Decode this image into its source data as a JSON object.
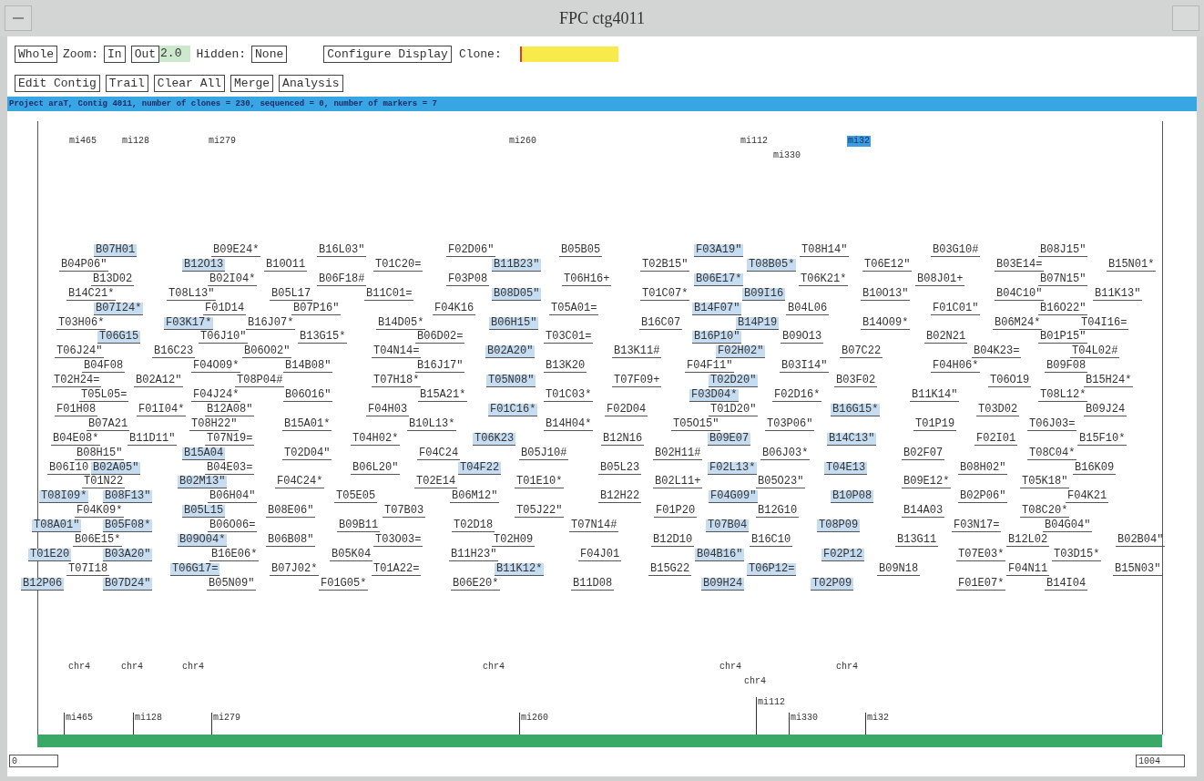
{
  "window": {
    "title": "FPC ctg4011"
  },
  "toolbar": {
    "row_1": [
      {
        "kind": "button",
        "label": "Whole"
      },
      {
        "kind": "label",
        "label": "Zoom:"
      },
      {
        "kind": "button",
        "label": "In"
      },
      {
        "kind": "button",
        "label": "Out"
      },
      {
        "kind": "value",
        "label": "2.0"
      },
      {
        "kind": "label",
        "label": "Hidden:"
      },
      {
        "kind": "button",
        "label": "None"
      },
      {
        "kind": "button",
        "label": "Configure Display"
      },
      {
        "kind": "label",
        "label": "Clone:"
      },
      {
        "kind": "field"
      }
    ],
    "row_2": [
      {
        "kind": "button",
        "label": "Edit Contig"
      },
      {
        "kind": "button",
        "label": "Trail"
      },
      {
        "kind": "button",
        "label": "Clear All"
      },
      {
        "kind": "button",
        "label": "Merge"
      },
      {
        "kind": "button",
        "label": "Analysis"
      }
    ]
  },
  "status_bar": "Project araT, Contig 4011, number of clones = 230, sequenced = 0, number of markers = 7",
  "markers": [
    {
      "label": "mi465",
      "selected": false
    },
    {
      "label": "mi128",
      "selected": false
    },
    {
      "label": "mi279",
      "selected": false
    },
    {
      "label": "mi260",
      "selected": false
    },
    {
      "label": "mi112",
      "selected": false
    },
    {
      "label": "mi32",
      "selected": true
    },
    {
      "label": "mi330",
      "selected": false
    }
  ],
  "clone_rows": [
    [
      {
        "name": "B07H01",
        "highlighted": true
      },
      {
        "name": "B09E24*",
        "highlighted": false
      },
      {
        "name": "B16L03\"",
        "highlighted": false
      },
      {
        "name": "F02D06\"",
        "highlighted": false
      },
      {
        "name": "B05B05",
        "highlighted": false
      },
      {
        "name": "F03A19\"",
        "highlighted": true
      },
      {
        "name": "T08H14\"",
        "highlighted": false
      },
      {
        "name": "B03G10#",
        "highlighted": false
      },
      {
        "name": "B08J15\"",
        "highlighted": false
      }
    ],
    [
      {
        "name": "B04P06\"",
        "highlighted": false
      },
      {
        "name": "B12O13",
        "highlighted": true
      },
      {
        "name": "B10O11",
        "highlighted": false
      },
      {
        "name": "T01C20=",
        "highlighted": false
      },
      {
        "name": "B11B23\"",
        "highlighted": true
      },
      {
        "name": "T02B15\"",
        "highlighted": false
      },
      {
        "name": "T08B05*",
        "highlighted": true
      },
      {
        "name": "T06E12\"",
        "highlighted": false
      },
      {
        "name": "B03E14=",
        "highlighted": false
      },
      {
        "name": "B15N01*",
        "highlighted": false
      }
    ],
    [
      {
        "name": "B13D02",
        "highlighted": false
      },
      {
        "name": "B02I04*",
        "highlighted": false
      },
      {
        "name": "B06F18#",
        "highlighted": false
      },
      {
        "name": "F03P08",
        "highlighted": false
      },
      {
        "name": "T06H16+",
        "highlighted": false
      },
      {
        "name": "B06E17*",
        "highlighted": true
      },
      {
        "name": "T06K21*",
        "highlighted": false
      },
      {
        "name": "B08J01+",
        "highlighted": false
      },
      {
        "name": "B07N15\"",
        "highlighted": false
      }
    ],
    [
      {
        "name": "B14C21*",
        "highlighted": false
      },
      {
        "name": "T08L13\"",
        "highlighted": false
      },
      {
        "name": "B05L17",
        "highlighted": false
      },
      {
        "name": "B11C01=",
        "highlighted": false
      },
      {
        "name": "B08D05\"",
        "highlighted": true
      },
      {
        "name": "T01C07*",
        "highlighted": false
      },
      {
        "name": "B09I16",
        "highlighted": true
      },
      {
        "name": "B10O13\"",
        "highlighted": false
      },
      {
        "name": "B04C10\"",
        "highlighted": false
      },
      {
        "name": "B11K13\"",
        "highlighted": false
      }
    ],
    [
      {
        "name": "B07I24*",
        "highlighted": true
      },
      {
        "name": "F01D14",
        "highlighted": false
      },
      {
        "name": "B07P16\"",
        "highlighted": false
      },
      {
        "name": "F04K16",
        "highlighted": false
      },
      {
        "name": "T05A01=",
        "highlighted": false
      },
      {
        "name": "B14F07\"",
        "highlighted": true
      },
      {
        "name": "B04L06",
        "highlighted": false
      },
      {
        "name": "F01C01\"",
        "highlighted": false
      },
      {
        "name": "B16O22\"",
        "highlighted": false
      }
    ],
    [
      {
        "name": "T03H06*",
        "highlighted": false
      },
      {
        "name": "F03K17*",
        "highlighted": true
      },
      {
        "name": "B16J07*",
        "highlighted": false
      },
      {
        "name": "B14D05*",
        "highlighted": false
      },
      {
        "name": "B06H15\"",
        "highlighted": true
      },
      {
        "name": "B16C07",
        "highlighted": false
      },
      {
        "name": "B14P19",
        "highlighted": true
      },
      {
        "name": "B14O09*",
        "highlighted": false
      },
      {
        "name": "B06M24*",
        "highlighted": false
      },
      {
        "name": "T04I16=",
        "highlighted": false
      }
    ],
    [
      {
        "name": "T06G15",
        "highlighted": true
      },
      {
        "name": "T06J10\"",
        "highlighted": false
      },
      {
        "name": "B13G15*",
        "highlighted": false
      },
      {
        "name": "B06D02=",
        "highlighted": false
      },
      {
        "name": "T03C01=",
        "highlighted": false
      },
      {
        "name": "B16P10\"",
        "highlighted": true
      },
      {
        "name": "B09O13",
        "highlighted": false
      },
      {
        "name": "B02N21",
        "highlighted": false
      },
      {
        "name": "B01P15\"",
        "highlighted": false
      }
    ],
    [
      {
        "name": "T06J24\"",
        "highlighted": false
      },
      {
        "name": "B16C23",
        "highlighted": false
      },
      {
        "name": "B06O02\"",
        "highlighted": false
      },
      {
        "name": "T04N14=",
        "highlighted": false
      },
      {
        "name": "B02A20\"",
        "highlighted": true
      },
      {
        "name": "B13K11#",
        "highlighted": false
      },
      {
        "name": "F02H02\"",
        "highlighted": true
      },
      {
        "name": "B07C22",
        "highlighted": false
      },
      {
        "name": "B04K23=",
        "highlighted": false
      },
      {
        "name": "T04L02#",
        "highlighted": false
      }
    ],
    [
      {
        "name": "B04F08",
        "highlighted": false
      },
      {
        "name": "F04O09*",
        "highlighted": false
      },
      {
        "name": "B14B08\"",
        "highlighted": false
      },
      {
        "name": "B16J17\"",
        "highlighted": false
      },
      {
        "name": "B13K20",
        "highlighted": false
      },
      {
        "name": "F04F11\"",
        "highlighted": false
      },
      {
        "name": "B03I14\"",
        "highlighted": false
      },
      {
        "name": "F04H06*",
        "highlighted": false
      },
      {
        "name": "B09F08",
        "highlighted": false
      }
    ],
    [
      {
        "name": "T02H24=",
        "highlighted": false
      },
      {
        "name": "B02A12\"",
        "highlighted": false
      },
      {
        "name": "T08P04#",
        "highlighted": false
      },
      {
        "name": "T07H18*",
        "highlighted": false
      },
      {
        "name": "T05N08\"",
        "highlighted": true
      },
      {
        "name": "T07F09+",
        "highlighted": false
      },
      {
        "name": "T02D20\"",
        "highlighted": true
      },
      {
        "name": "B03F02",
        "highlighted": false
      },
      {
        "name": "T06O19",
        "highlighted": false
      },
      {
        "name": "B15H24*",
        "highlighted": false
      }
    ],
    [
      {
        "name": "T05L05=",
        "highlighted": false
      },
      {
        "name": "F04J24*",
        "highlighted": false
      },
      {
        "name": "B06O16\"",
        "highlighted": false
      },
      {
        "name": "B15A21*",
        "highlighted": false
      },
      {
        "name": "T01C03*",
        "highlighted": false
      },
      {
        "name": "F03D04*",
        "highlighted": true
      },
      {
        "name": "F02D16*",
        "highlighted": false
      },
      {
        "name": "B11K14\"",
        "highlighted": false
      },
      {
        "name": "T08L12*",
        "highlighted": false
      }
    ],
    [
      {
        "name": "F01H08",
        "highlighted": false
      },
      {
        "name": "F01I04*",
        "highlighted": false
      },
      {
        "name": "B12A08\"",
        "highlighted": false
      },
      {
        "name": "F04H03",
        "highlighted": false
      },
      {
        "name": "F01C16*",
        "highlighted": true
      },
      {
        "name": "F02D04",
        "highlighted": false
      },
      {
        "name": "T01D20\"",
        "highlighted": false
      },
      {
        "name": "B16G15*",
        "highlighted": true
      },
      {
        "name": "T03D02",
        "highlighted": false
      },
      {
        "name": "B09J24",
        "highlighted": false
      }
    ],
    [
      {
        "name": "B07A21",
        "highlighted": false
      },
      {
        "name": "T08H22\"",
        "highlighted": false
      },
      {
        "name": "B15A01*",
        "highlighted": false
      },
      {
        "name": "B10L13*",
        "highlighted": false
      },
      {
        "name": "B14H04*",
        "highlighted": false
      },
      {
        "name": "T05O15\"",
        "highlighted": false
      },
      {
        "name": "T03P06\"",
        "highlighted": false
      },
      {
        "name": "T01P19",
        "highlighted": false
      },
      {
        "name": "T06J03=",
        "highlighted": false
      }
    ],
    [
      {
        "name": "B04E08*",
        "highlighted": false
      },
      {
        "name": "B11D11\"",
        "highlighted": false
      },
      {
        "name": "T07N19=",
        "highlighted": false
      },
      {
        "name": "T04H02*",
        "highlighted": false
      },
      {
        "name": "T06K23",
        "highlighted": true
      },
      {
        "name": "B12N16",
        "highlighted": false
      },
      {
        "name": "B09E07",
        "highlighted": true
      },
      {
        "name": "B14C13\"",
        "highlighted": true
      },
      {
        "name": "F02I01",
        "highlighted": false
      },
      {
        "name": "B15F10*",
        "highlighted": false
      }
    ],
    [
      {
        "name": "B08H15\"",
        "highlighted": false
      },
      {
        "name": "B15A04",
        "highlighted": true
      },
      {
        "name": "T02D04\"",
        "highlighted": false
      },
      {
        "name": "F04C24",
        "highlighted": false
      },
      {
        "name": "B05J10#",
        "highlighted": false
      },
      {
        "name": "B02H11#",
        "highlighted": false
      },
      {
        "name": "B06J03*",
        "highlighted": false
      },
      {
        "name": "B02F07",
        "highlighted": false
      },
      {
        "name": "T08C04*",
        "highlighted": false
      }
    ],
    [
      {
        "name": "B06I10",
        "highlighted": false
      },
      {
        "name": "B02A05\"",
        "highlighted": true
      },
      {
        "name": "B04E03=",
        "highlighted": false
      },
      {
        "name": "B06L20\"",
        "highlighted": false
      },
      {
        "name": "T04F22",
        "highlighted": true
      },
      {
        "name": "B05L23",
        "highlighted": false
      },
      {
        "name": "F02L13*",
        "highlighted": true
      },
      {
        "name": "T04E13",
        "highlighted": true
      },
      {
        "name": "B08H02\"",
        "highlighted": false
      },
      {
        "name": "B16K09",
        "highlighted": false
      }
    ],
    [
      {
        "name": "T01N22",
        "highlighted": false
      },
      {
        "name": "B02M13\"",
        "highlighted": true
      },
      {
        "name": "F04C24*",
        "highlighted": false
      },
      {
        "name": "T02E14",
        "highlighted": false
      },
      {
        "name": "T01E10*",
        "highlighted": false
      },
      {
        "name": "B02L11+",
        "highlighted": false
      },
      {
        "name": "B05O23\"",
        "highlighted": false
      },
      {
        "name": "B09E12*",
        "highlighted": false
      },
      {
        "name": "T05K18\"",
        "highlighted": false
      }
    ],
    [
      {
        "name": "T08I09*",
        "highlighted": true
      },
      {
        "name": "B08F13\"",
        "highlighted": true
      },
      {
        "name": "B06H04\"",
        "highlighted": false
      },
      {
        "name": "T05E05",
        "highlighted": false
      },
      {
        "name": "B06M12\"",
        "highlighted": false
      },
      {
        "name": "B12H22",
        "highlighted": false
      },
      {
        "name": "F04G09\"",
        "highlighted": true
      },
      {
        "name": "B10P08",
        "highlighted": true
      },
      {
        "name": "B02P06\"",
        "highlighted": false
      },
      {
        "name": "F04K21",
        "highlighted": false
      }
    ],
    [
      {
        "name": "F04K09*",
        "highlighted": false
      },
      {
        "name": "B05L15",
        "highlighted": true
      },
      {
        "name": "B08E06\"",
        "highlighted": false
      },
      {
        "name": "T07B03",
        "highlighted": false
      },
      {
        "name": "T05J22\"",
        "highlighted": false
      },
      {
        "name": "F01P20",
        "highlighted": false
      },
      {
        "name": "B12G10",
        "highlighted": false
      },
      {
        "name": "B14A03",
        "highlighted": false
      },
      {
        "name": "T08C20*",
        "highlighted": false
      }
    ],
    [
      {
        "name": "T08A01\"",
        "highlighted": true
      },
      {
        "name": "B05F08*",
        "highlighted": true
      },
      {
        "name": "B06O06=",
        "highlighted": false
      },
      {
        "name": "B09B11",
        "highlighted": false
      },
      {
        "name": "T02D18",
        "highlighted": false
      },
      {
        "name": "T07N14#",
        "highlighted": false
      },
      {
        "name": "T07B04",
        "highlighted": true
      },
      {
        "name": "T08P09",
        "highlighted": true
      },
      {
        "name": "F03N17=",
        "highlighted": false
      },
      {
        "name": "B04G04\"",
        "highlighted": false
      }
    ],
    [
      {
        "name": "B06E15*",
        "highlighted": false
      },
      {
        "name": "B09O04*",
        "highlighted": true
      },
      {
        "name": "B06B08\"",
        "highlighted": false
      },
      {
        "name": "T03O03=",
        "highlighted": false
      },
      {
        "name": "T02H09",
        "highlighted": false
      },
      {
        "name": "B12D10",
        "highlighted": false
      },
      {
        "name": "B16C10",
        "highlighted": false
      },
      {
        "name": "B13G11",
        "highlighted": false
      },
      {
        "name": "B12L02",
        "highlighted": false
      },
      {
        "name": "B02B04\"",
        "highlighted": false
      }
    ],
    [
      {
        "name": "T01E20",
        "highlighted": true
      },
      {
        "name": "B03A20\"",
        "highlighted": true
      },
      {
        "name": "B16E06*",
        "highlighted": false
      },
      {
        "name": "B05K04",
        "highlighted": false
      },
      {
        "name": "B11H23\"",
        "highlighted": false
      },
      {
        "name": "F04J01",
        "highlighted": false
      },
      {
        "name": "B04B16\"",
        "highlighted": true
      },
      {
        "name": "F02P12",
        "highlighted": true
      },
      {
        "name": "T07E03*",
        "highlighted": false
      },
      {
        "name": "T03D15*",
        "highlighted": false
      }
    ],
    [
      {
        "name": "T07I18",
        "highlighted": false
      },
      {
        "name": "T06G17=",
        "highlighted": true
      },
      {
        "name": "B07J02*",
        "highlighted": false
      },
      {
        "name": "T01A22=",
        "highlighted": false
      },
      {
        "name": "B11K12*",
        "highlighted": true
      },
      {
        "name": "B15G22",
        "highlighted": false
      },
      {
        "name": "T06P12=",
        "highlighted": true
      },
      {
        "name": "B09N18",
        "highlighted": false
      },
      {
        "name": "F04N11",
        "highlighted": false
      },
      {
        "name": "B15N03\"",
        "highlighted": false
      }
    ],
    [
      {
        "name": "B12P06",
        "highlighted": true
      },
      {
        "name": "B07D24\"",
        "highlighted": true
      },
      {
        "name": "B05N09\"",
        "highlighted": false
      },
      {
        "name": "F01G05*",
        "highlighted": false
      },
      {
        "name": "B06E20*",
        "highlighted": false
      },
      {
        "name": "B11D08",
        "highlighted": false
      },
      {
        "name": "B09H24",
        "highlighted": true
      },
      {
        "name": "T02P09",
        "highlighted": true
      },
      {
        "name": "F01E07*",
        "highlighted": false
      },
      {
        "name": "B14I04",
        "highlighted": false
      }
    ]
  ],
  "chromosome_labels": [
    "chr4",
    "chr4",
    "chr4",
    "chr4",
    "chr4",
    "chr4",
    "chr4"
  ],
  "marker_ticks": [
    "mi465",
    "mi128",
    "mi279",
    "mi260",
    "mi112",
    "mi330",
    "mi32"
  ],
  "range": {
    "start": "0",
    "end": "1004"
  }
}
